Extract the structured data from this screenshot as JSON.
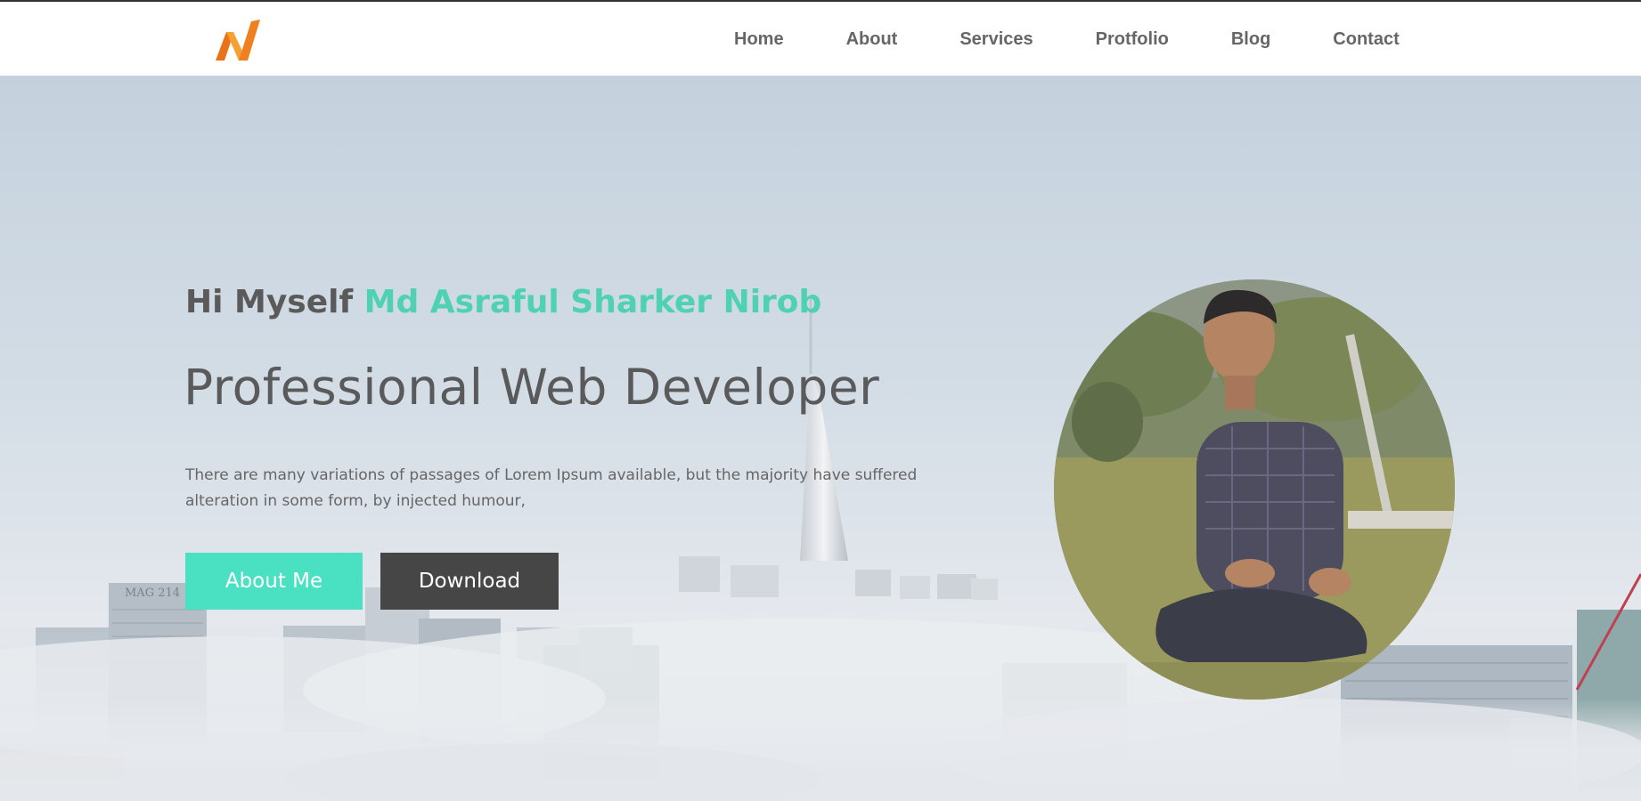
{
  "header": {
    "logo_name": "logo-icon",
    "nav": [
      {
        "label": "Home"
      },
      {
        "label": "About"
      },
      {
        "label": "Services"
      },
      {
        "label": "Protfolio"
      },
      {
        "label": "Blog"
      },
      {
        "label": "Contact"
      }
    ]
  },
  "hero": {
    "greeting_prefix": "Hi Myself ",
    "greeting_name": "Md Asraful Sharker Nirob",
    "title": "Professional Web Developer",
    "description": "There are many variations of passages of Lorem Ipsum available, but the majority have suffered alteration in some form, by injected humour,",
    "buttons": {
      "about": "About Me",
      "download": "Download"
    },
    "building_sign": "MAG 214"
  },
  "colors": {
    "accent": "#4ae0c2",
    "name_text": "#4fd1b4",
    "dark_button": "#464646",
    "logo_orange": "#f07f1f"
  }
}
